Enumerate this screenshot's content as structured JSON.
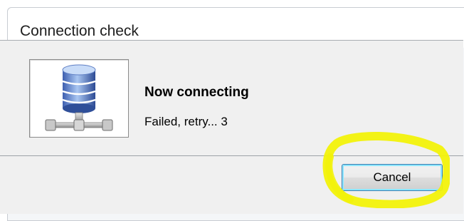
{
  "dialog": {
    "title": "Connection check",
    "heading": "Now connecting",
    "status": "Failed, retry... 3",
    "icon": "database-server-icon",
    "cancel_label": "Cancel"
  },
  "colors": {
    "highlight": "#f2f20a",
    "button_focus": "#8de6ff",
    "button_border": "#3c7fb1"
  }
}
